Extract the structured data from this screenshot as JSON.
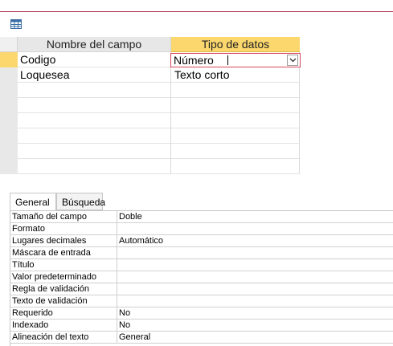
{
  "grid": {
    "col_name_header": "Nombre del campo",
    "col_type_header": "Tipo de datos",
    "rows": [
      {
        "name": "Codigo",
        "type": "Número"
      },
      {
        "name": "Loquesea",
        "type": "Texto corto"
      }
    ]
  },
  "properties": {
    "tabs": [
      "General",
      "Búsqueda"
    ],
    "rows": [
      {
        "label": "Tamaño del campo",
        "value": "Doble"
      },
      {
        "label": "Formato",
        "value": ""
      },
      {
        "label": "Lugares decimales",
        "value": "Automático"
      },
      {
        "label": "Máscara de entrada",
        "value": ""
      },
      {
        "label": "Título",
        "value": ""
      },
      {
        "label": "Valor predeterminado",
        "value": ""
      },
      {
        "label": "Regla de validación",
        "value": ""
      },
      {
        "label": "Texto de validación",
        "value": ""
      },
      {
        "label": "Requerido",
        "value": "No"
      },
      {
        "label": "Indexado",
        "value": "No"
      },
      {
        "label": "Alineación del texto",
        "value": "General"
      }
    ]
  },
  "colors": {
    "accent": "#fbd76d",
    "combo_border": "#d9465f",
    "top_line": "#b0344a"
  },
  "icons": {
    "table": "table-icon",
    "dropdown": "chevron-down-icon"
  }
}
